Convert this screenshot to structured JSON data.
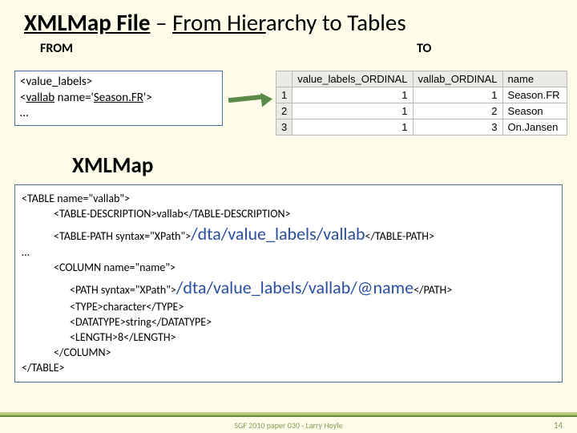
{
  "title": {
    "part1": "XMLMap File",
    "sep": " – ",
    "part2_a": "From Hier",
    "part2_b": "archy to Tables"
  },
  "labels": {
    "from": "FROM",
    "to": "TO"
  },
  "from_box": {
    "l1a": "<value",
    "l1b": "_",
    "l1c": "labels>",
    "l2a": "<",
    "l2b": "vallab",
    "l2c": " name='",
    "l2d": "Season.FR",
    "l2e": "'>",
    "l3": "…"
  },
  "table": {
    "headers": [
      "",
      "value_labels_ORDINAL",
      "vallab_ORDINAL",
      "name"
    ],
    "rows": [
      [
        "1",
        "1",
        "1",
        "Season.FR"
      ],
      [
        "2",
        "1",
        "2",
        "Season"
      ],
      [
        "3",
        "1",
        "3",
        "On.Jansen"
      ]
    ]
  },
  "xmlmap_heading": "XMLMap",
  "code": {
    "l1": "<TABLE name=\"vallab\">",
    "l2": "<TABLE-DESCRIPTION>vallab</TABLE-DESCRIPTION>",
    "l3a": "<TABLE-PATH syntax=\"XPath\">",
    "l3b": "/dta/value_labels/vallab",
    "l3c": "</TABLE-PATH>",
    "ell": "…",
    "l4": "<COLUMN name=\"name\">",
    "l5a": "<PATH syntax=\"XPath\">",
    "l5b": "/dta/value_labels/vallab/@name",
    "l5c": "</PATH>",
    "l6": "<TYPE>character</TYPE>",
    "l7": "<DATATYPE>string</DATATYPE>",
    "l8": "<LENGTH>8</LENGTH>",
    "l9": "</COLUMN>",
    "l10": "</TABLE>"
  },
  "footer": {
    "text": "SGF 2010 paper 030 - Larry Hoyle",
    "page": "14"
  }
}
